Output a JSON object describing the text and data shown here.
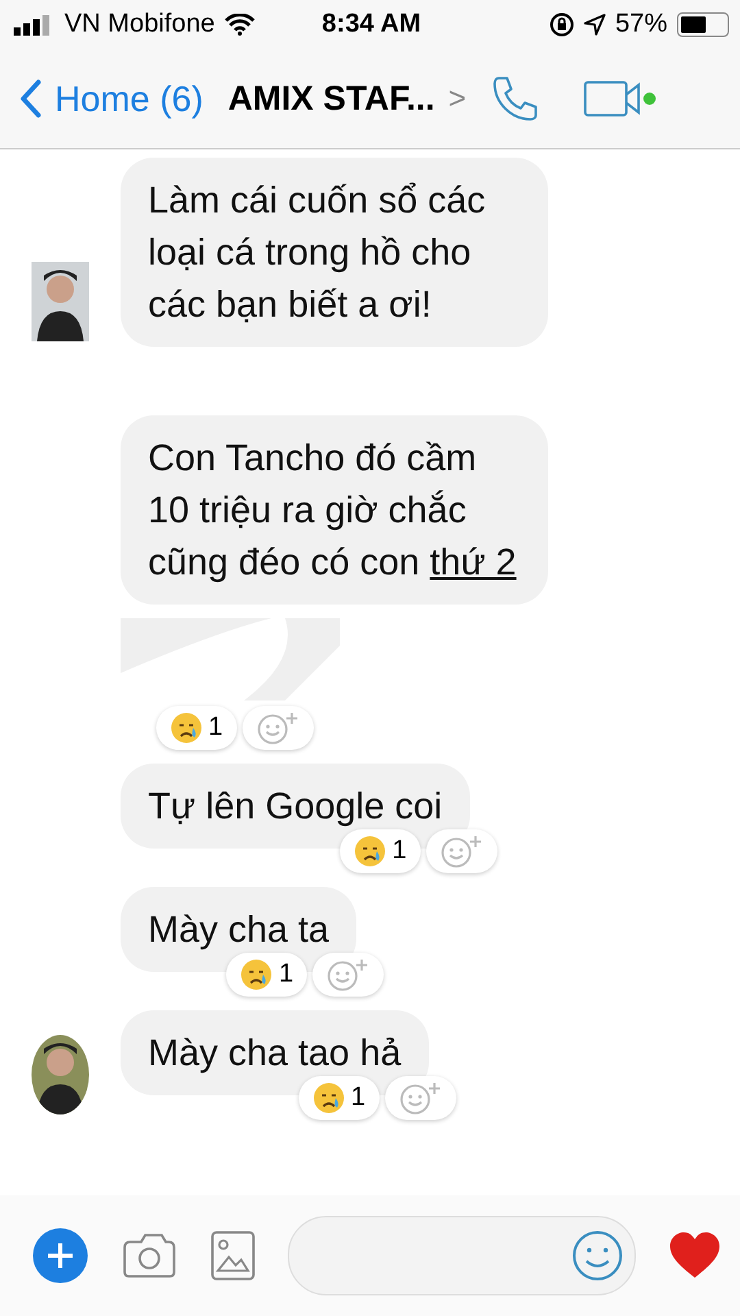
{
  "status_bar": {
    "carrier": "VN Mobifone",
    "time": "8:34 AM",
    "battery": "57%"
  },
  "nav": {
    "back": "Home (6)",
    "title": "AMIX STAF...",
    "chevron": ">",
    "video_online": true
  },
  "messages": [
    {
      "kind": "text",
      "text": "Làm cái cuốn sổ các loại cá trong hồ cho các bạn biết a ơi!",
      "avatar": true
    },
    {
      "kind": "text",
      "text": "Con Tancho đó cầm 10 triệu ra giờ chắc cũng đéo có con",
      "link": "thứ 2",
      "avatar": false
    },
    {
      "kind": "hidden",
      "avatar": false,
      "reaction": {
        "count": "1"
      }
    },
    {
      "kind": "text",
      "text": "Tự lên Google coi",
      "avatar": false,
      "reaction": {
        "count": "1"
      }
    },
    {
      "kind": "text",
      "text": "Mày cha ta",
      "avatar": false,
      "reaction": {
        "count": "1"
      }
    },
    {
      "kind": "text",
      "text": "Mày cha tao hả",
      "avatar": true,
      "reaction": {
        "count": "1"
      }
    }
  ]
}
